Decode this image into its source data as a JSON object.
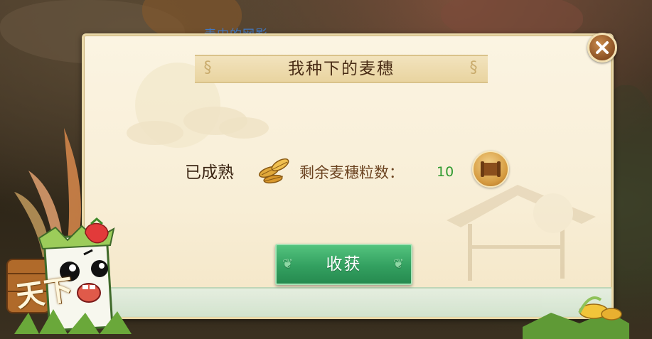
{
  "background": {
    "player_name_text": "麦中的网影"
  },
  "dialog": {
    "title": "我种下的麦穗",
    "status_label": "已成熟",
    "remaining_label": "剩余麦穗粒数：",
    "remaining_value": "10",
    "harvest_button_label": "收获",
    "close_icon": "close-icon",
    "wheat_icon": "wheat-grain-icon",
    "scroll_icon": "scroll-icon"
  },
  "logo": {
    "text": "天下"
  },
  "colors": {
    "title_text": "#4a2d16",
    "remaining_value": "#2f9a2f",
    "harvest_button": "#33a060",
    "close_button": "#8a5023"
  }
}
